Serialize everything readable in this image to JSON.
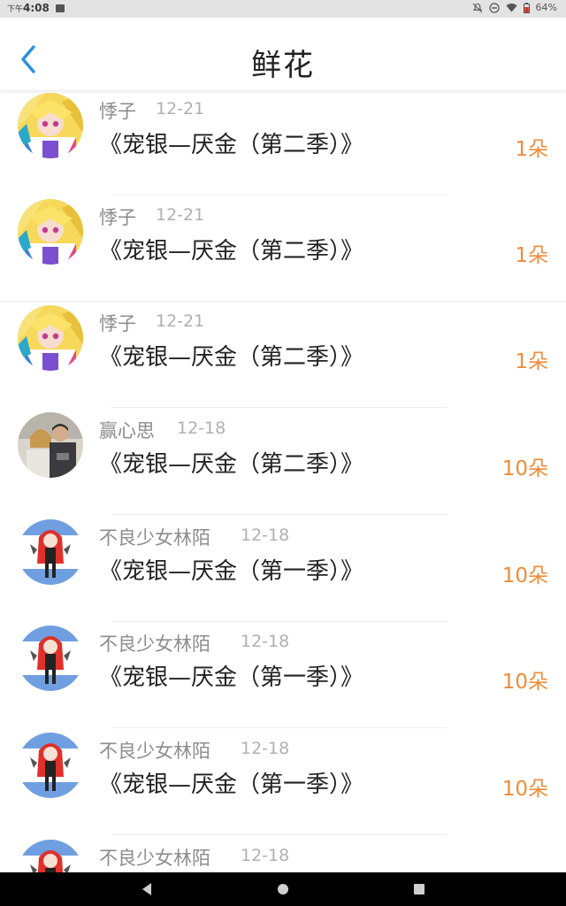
{
  "status_bar": {
    "ampm": "下午",
    "time": "4:08",
    "battery": "64%",
    "icons": [
      "image-icon",
      "mute-icon",
      "dnd-icon",
      "wifi-icon",
      "battery-icon"
    ]
  },
  "header": {
    "title": "鲜花",
    "back_icon": "chevron-left-icon",
    "accent_color": "#2a8fe0"
  },
  "records": [
    {
      "user": "悸子",
      "date": "12-21",
      "title": "《宠银—厌金（第二季）》",
      "flowers": "1朵",
      "avatar": "anime-blonde-avatar"
    },
    {
      "user": "悸子",
      "date": "12-21",
      "title": "《宠银—厌金（第二季）》",
      "flowers": "1朵",
      "avatar": "anime-blonde-avatar"
    },
    {
      "user": "悸子",
      "date": "12-21",
      "title": "《宠银—厌金（第二季）》",
      "flowers": "1朵",
      "avatar": "anime-blonde-avatar"
    },
    {
      "user": "赢心思",
      "date": "12-18",
      "title": "《宠银—厌金（第二季）》",
      "flowers": "10朵",
      "avatar": "couple-photo-avatar"
    },
    {
      "user": "不良少女林陌",
      "date": "12-18",
      "title": "《宠银—厌金（第一季）》",
      "flowers": "10朵",
      "avatar": "redhead-chibi-avatar"
    },
    {
      "user": "不良少女林陌",
      "date": "12-18",
      "title": "《宠银—厌金（第一季）》",
      "flowers": "10朵",
      "avatar": "redhead-chibi-avatar"
    },
    {
      "user": "不良少女林陌",
      "date": "12-18",
      "title": "《宠银—厌金（第一季）》",
      "flowers": "10朵",
      "avatar": "redhead-chibi-avatar"
    },
    {
      "user": "不良少女林陌",
      "date": "12-18",
      "title": "",
      "flowers": "",
      "avatar": "redhead-chibi-avatar"
    }
  ],
  "colors": {
    "flower_count": "#f08b3a",
    "username": "#8c8c8c",
    "date": "#b0b0b0"
  },
  "nav": {
    "icons": [
      "back-triangle-icon",
      "home-circle-icon",
      "recents-square-icon"
    ]
  }
}
